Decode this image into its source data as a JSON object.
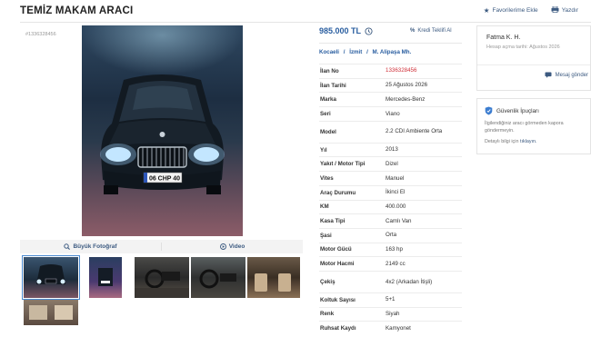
{
  "header": {
    "title": "TEMİZ MAKAM ARACI",
    "favorites_label": "Favorilerime Ekle",
    "print_label": "Yazdır"
  },
  "listing": {
    "id_label": "#1336328456",
    "price": "985.000 TL",
    "credit_label": "Kredi Teklifi Al",
    "location": {
      "city": "Kocaeli",
      "district": "İzmit",
      "neighborhood": "M. Alipaşa Mh.",
      "separator": "/"
    }
  },
  "photo_bar": {
    "big_photo_label": "Büyük Fotoğraf",
    "video_label": "Video"
  },
  "details": [
    {
      "key": "İlan No",
      "value": "1336328456",
      "highlight": true
    },
    {
      "key": "İlan Tarihi",
      "value": "25 Ağustos 2026"
    },
    {
      "key": "Marka",
      "value": "Mercedes-Benz"
    },
    {
      "key": "Seri",
      "value": "Viano"
    },
    {
      "key": "Model",
      "value": "2.2 CDI Ambiente Orta"
    },
    {
      "key": "Yıl",
      "value": "2013"
    },
    {
      "key": "Yakıt / Motor Tipi",
      "value": "Dizel"
    },
    {
      "key": "Vites",
      "value": "Manuel"
    },
    {
      "key": "Araç Durumu",
      "value": "İkinci El"
    },
    {
      "key": "KM",
      "value": "400.000"
    },
    {
      "key": "Kasa Tipi",
      "value": "Camlı Van"
    },
    {
      "key": "Şasi",
      "value": "Orta"
    },
    {
      "key": "Motor Gücü",
      "value": "163 hp"
    },
    {
      "key": "Motor Hacmi",
      "value": "2149 cc"
    },
    {
      "key": "Çekiş",
      "value": "4x2 (Arkadan İtişli)"
    },
    {
      "key": "Koltuk Sayısı",
      "value": "5+1"
    },
    {
      "key": "Renk",
      "value": "Siyah"
    },
    {
      "key": "Ruhsat Kaydı",
      "value": "Kamyonet"
    }
  ],
  "seller": {
    "name": "Fatma K. H.",
    "since": "Hesap açma tarihi: Ağustos 2026",
    "message_label": "Mesaj gönder"
  },
  "tips": {
    "title": "Güvenlik İpuçları",
    "text": "İlgilendiğiniz aracı görmeden kapora göndermeyin.",
    "more_prefix": "Detaylı bilgi için",
    "more_link": "tıklayın."
  },
  "plate": "06 CHP 40",
  "colors": {
    "accent": "#2a5ea0",
    "link": "#3c5a80",
    "highlight": "#d0313a"
  }
}
